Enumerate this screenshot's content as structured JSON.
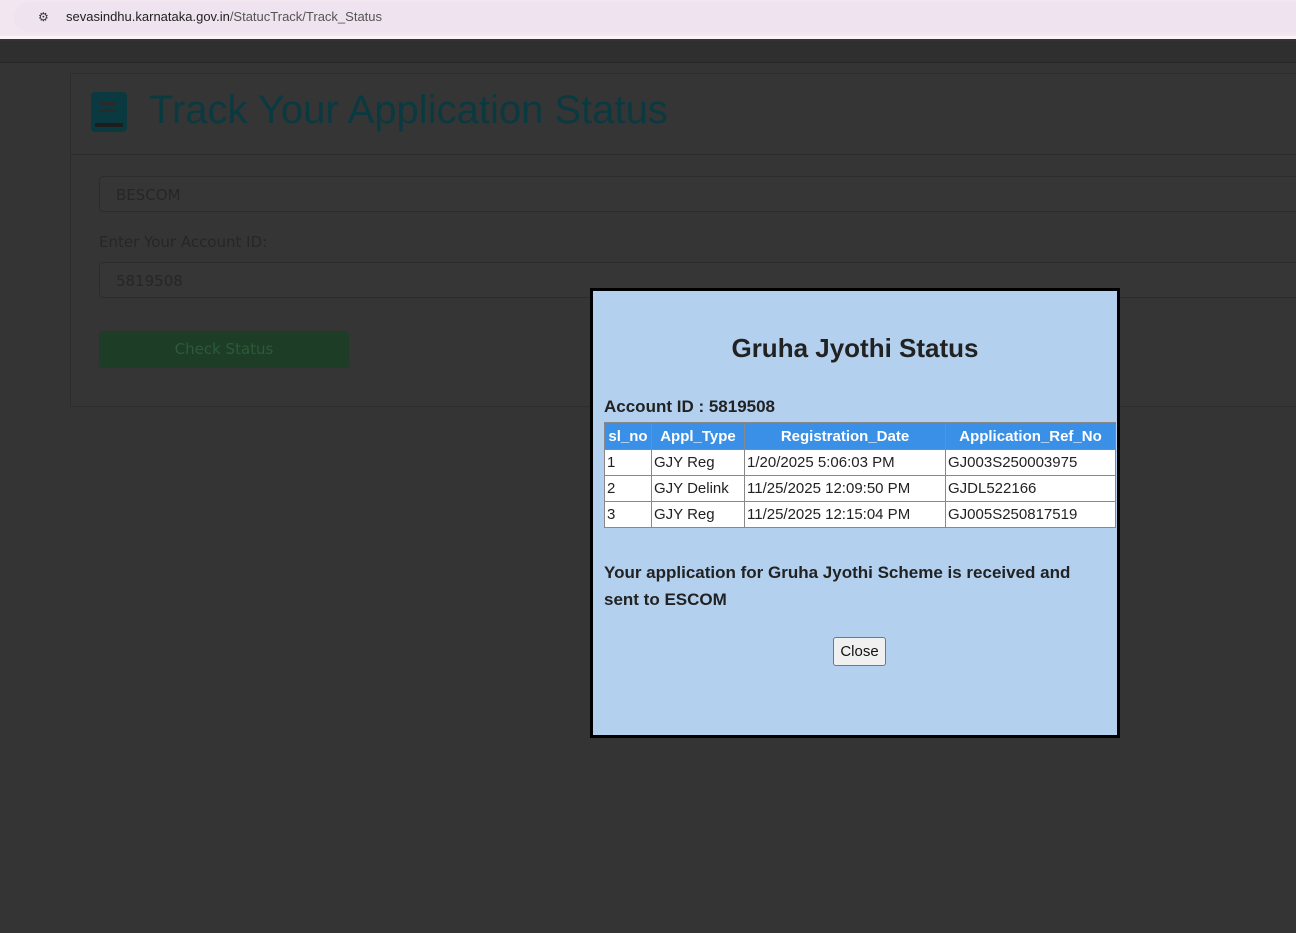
{
  "browser": {
    "url_host": "sevasindhu.karnataka.gov.in",
    "url_path": "/StatucTrack/Track_Status"
  },
  "page": {
    "title": "Track Your Application Status",
    "escom_select": "BESCOM",
    "account_label": "Enter Your Account ID:",
    "account_value": "5819508",
    "check_button": "Check Status"
  },
  "modal": {
    "title": "Gruha Jyothi Status",
    "account_line": "Account ID : 5819508",
    "columns": [
      "sl_no",
      "Appl_Type",
      "Registration_Date",
      "Application_Ref_No"
    ],
    "rows": [
      [
        "1",
        "GJY Reg",
        "1/20/2025 5:06:03 PM",
        "GJ003S250003975"
      ],
      [
        "2",
        "GJY Delink",
        "11/25/2025 12:09:50 PM",
        "GJDL522166"
      ],
      [
        "3",
        "GJY Reg",
        "11/25/2025 12:15:04 PM",
        "GJ005S250817519"
      ]
    ],
    "message": "Your application for Gruha Jyothi Scheme is received and sent to ESCOM",
    "close_button": "Close"
  }
}
